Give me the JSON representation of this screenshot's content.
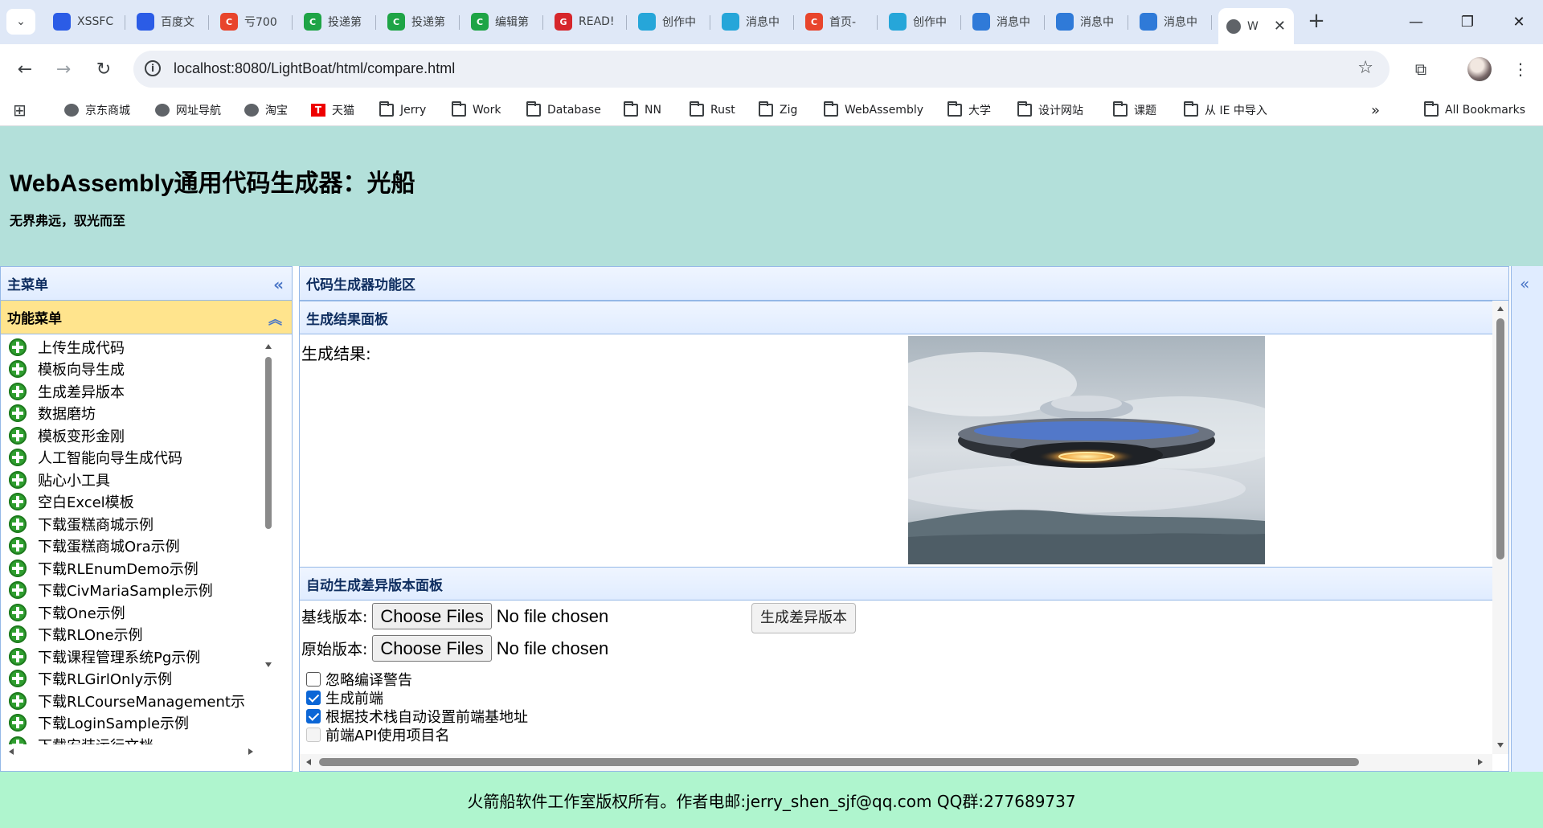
{
  "browser": {
    "tabs": [
      {
        "label": "XSSFC",
        "color": "#2b5ce6",
        "glyph": "paw-icon"
      },
      {
        "label": "百度文",
        "color": "#2b5ce6",
        "glyph": "paw-icon"
      },
      {
        "label": "亏700",
        "color": "#e8452c",
        "glyph": "C"
      },
      {
        "label": "投递第",
        "color": "#1ea446",
        "glyph": "C"
      },
      {
        "label": "投递第",
        "color": "#1ea446",
        "glyph": "C"
      },
      {
        "label": "编辑第",
        "color": "#1ea446",
        "glyph": "C"
      },
      {
        "label": "READ!",
        "color": "#d6262b",
        "glyph": "G"
      },
      {
        "label": "创作中",
        "color": "#26a6d9",
        "glyph": "tv-icon"
      },
      {
        "label": "消息中",
        "color": "#26a6d9",
        "glyph": "tv-icon"
      },
      {
        "label": "首页-",
        "color": "#e8452c",
        "glyph": "C"
      },
      {
        "label": "创作中",
        "color": "#26a6d9",
        "glyph": "tv-icon"
      },
      {
        "label": "消息中",
        "color": "#2f7ad8",
        "glyph": "robot-icon"
      },
      {
        "label": "消息中",
        "color": "#2f7ad8",
        "glyph": "robot-icon"
      },
      {
        "label": "消息中",
        "color": "#2f7ad8",
        "glyph": "robot-icon"
      }
    ],
    "active_tab": {
      "label": "W"
    },
    "url": "localhost:8080/LightBoat/html/compare.html",
    "bookmarks": [
      {
        "label": "京东商城",
        "icon": "globe"
      },
      {
        "label": "网址导航",
        "icon": "globe"
      },
      {
        "label": "淘宝",
        "icon": "globe"
      },
      {
        "label": "天猫",
        "icon": "tmall"
      },
      {
        "label": "Jerry",
        "icon": "folder"
      },
      {
        "label": "Work",
        "icon": "folder"
      },
      {
        "label": "Database",
        "icon": "folder"
      },
      {
        "label": "NN",
        "icon": "folder"
      },
      {
        "label": "Rust",
        "icon": "folder"
      },
      {
        "label": "Zig",
        "icon": "folder"
      },
      {
        "label": "WebAssembly",
        "icon": "folder"
      },
      {
        "label": "大学",
        "icon": "folder"
      },
      {
        "label": "设计网站",
        "icon": "folder"
      },
      {
        "label": "课题",
        "icon": "folder"
      },
      {
        "label": "从 IE 中导入",
        "icon": "folder"
      }
    ],
    "all_bookmarks": "All Bookmarks",
    "overflow": "»"
  },
  "header": {
    "title": "WebAssembly通用代码生成器：光船",
    "subtitle": "无界弗远，驭光而至"
  },
  "left": {
    "title": "主菜单",
    "section": "功能菜单",
    "items": [
      "上传生成代码",
      "模板向导生成",
      "生成差异版本",
      "数据磨坊",
      "模板变形金刚",
      "人工智能向导生成代码",
      "贴心小工具",
      "空白Excel模板",
      "下载蛋糕商城示例",
      "下载蛋糕商城Ora示例",
      "下载RLEnumDemo示例",
      "下载CivMariaSample示例",
      "下载One示例",
      "下载RLOne示例",
      "下载课程管理系统Pg示例",
      "下载RLGirlOnly示例",
      "下载RLCourseManagement示",
      "下载LoginSample示例",
      "下载安装运行文档"
    ]
  },
  "main": {
    "title": "代码生成器功能区",
    "result_panel": "生成结果面板",
    "result_label": "生成结果:",
    "diff_panel": "自动生成差异版本面板",
    "baseline_label": "基线版本:",
    "original_label": "原始版本:",
    "choose_files": "Choose Files",
    "no_file": "No file chosen",
    "generate_button": "生成差异版本",
    "options": [
      {
        "label": "忽略编译警告",
        "checked": false
      },
      {
        "label": "生成前端",
        "checked": true
      },
      {
        "label": "根据技术栈自动设置前端基地址",
        "checked": true
      },
      {
        "label": "前端API使用项目名",
        "checked": false
      }
    ]
  },
  "footer": "火箭船软件工作室版权所有。作者电邮:jerry_shen_sjf@qq.com QQ群:277689737"
}
